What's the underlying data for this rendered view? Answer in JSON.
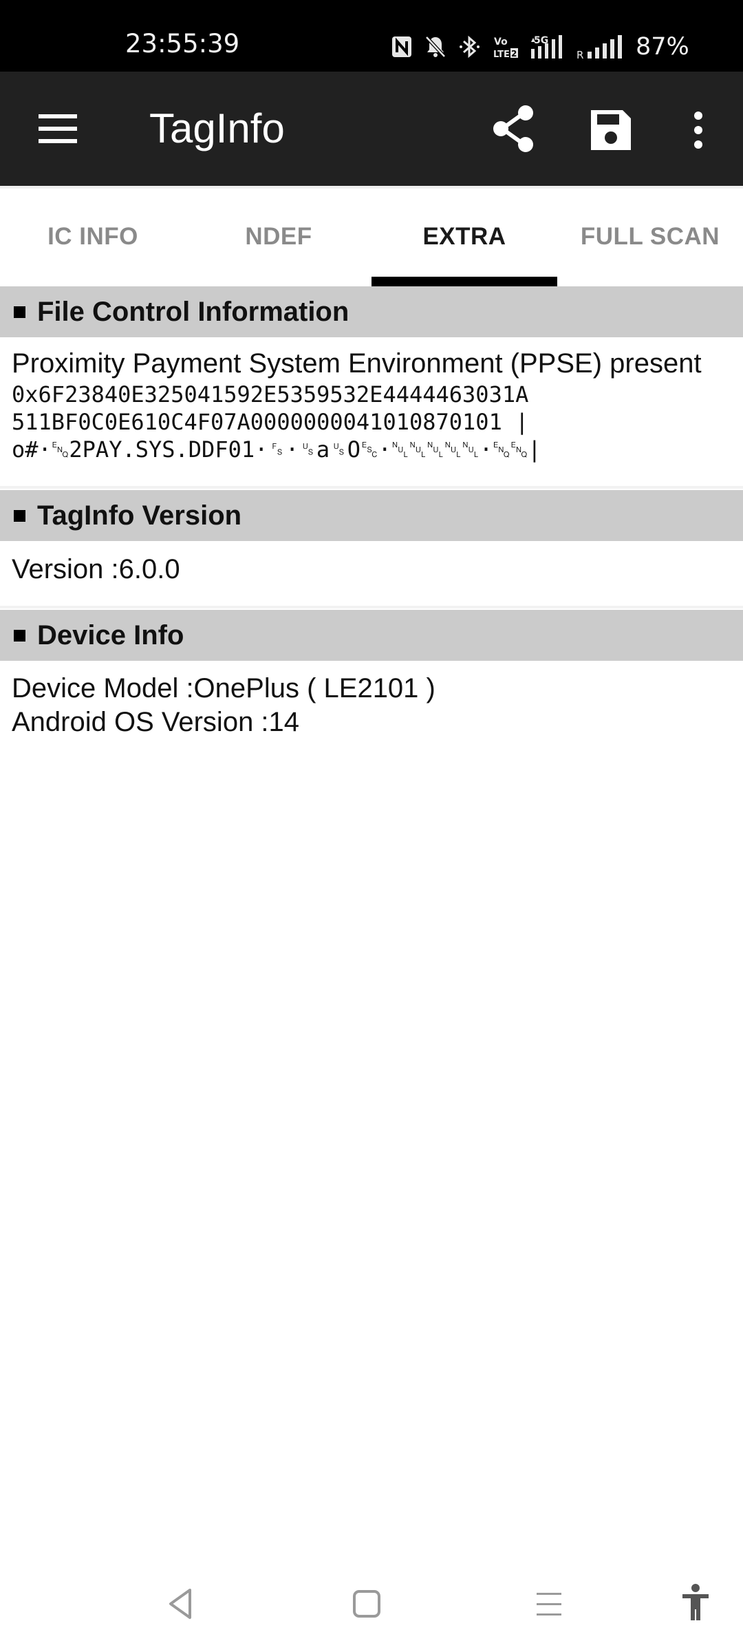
{
  "status_bar": {
    "time": "23:55:39",
    "battery": "87%",
    "icons": [
      "nfc-icon",
      "mute-icon",
      "bluetooth-icon",
      "volte-icon",
      "5g-signal-icon",
      "roaming-signal-icon"
    ],
    "volte_label": "Vo LTE2",
    "network_label": "5G",
    "roaming_label": "R"
  },
  "app_bar": {
    "title": "TagInfo",
    "background": "#212121"
  },
  "tabs": [
    {
      "label": "IC INFO",
      "active": false
    },
    {
      "label": "NDEF",
      "active": false
    },
    {
      "label": "EXTRA",
      "active": true
    },
    {
      "label": "FULL SCAN",
      "active": false
    }
  ],
  "sections": {
    "fci": {
      "title": "File Control Information",
      "description": "Proximity Payment System Environment (PPSE) present",
      "hex_line_1": "0x6F23840E325041592E5359532E4444463031A",
      "hex_line_2": "511BF0C0E610C4F07A0000000041010870101 |",
      "ascii_line": "o#·␅2PAY.SYS.DDF01·␜·␟a␟O␛·␀␀␀␀␀·␅␅|"
    },
    "version": {
      "title": "TagInfo Version",
      "line": "Version :6.0.0"
    },
    "device": {
      "title": "Device Info",
      "model_line": "Device Model :OnePlus ( LE2101 )",
      "os_line": "Android OS Version :14"
    }
  },
  "nav_bar": {
    "buttons": [
      "back-icon",
      "home-icon",
      "recents-icon",
      "accessibility-icon"
    ]
  }
}
